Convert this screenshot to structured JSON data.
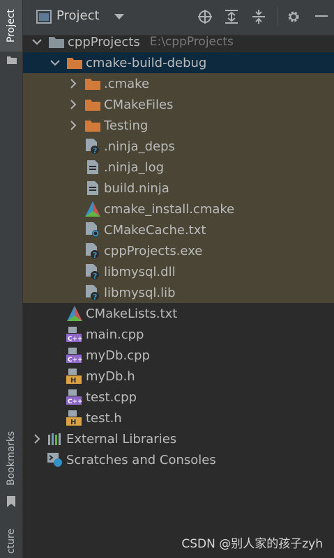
{
  "side_tabs": {
    "project": "Project",
    "bookmarks": "Bookmarks",
    "structure": "cture"
  },
  "header": {
    "title": "Project"
  },
  "tree": {
    "root": {
      "name": "cppProjects",
      "path": "E:\\cppProjects"
    },
    "build_dir": "cmake-build-debug",
    "build_items": [
      {
        "name": ".cmake",
        "kind": "folder"
      },
      {
        "name": "CMakeFiles",
        "kind": "folder"
      },
      {
        "name": "Testing",
        "kind": "folder"
      },
      {
        "name": ".ninja_deps",
        "kind": "unknown"
      },
      {
        "name": ".ninja_log",
        "kind": "text"
      },
      {
        "name": "build.ninja",
        "kind": "text"
      },
      {
        "name": "cmake_install.cmake",
        "kind": "cmake"
      },
      {
        "name": "CMakeCache.txt",
        "kind": "settings"
      },
      {
        "name": "cppProjects.exe",
        "kind": "unknown"
      },
      {
        "name": "libmysql.dll",
        "kind": "unknown"
      },
      {
        "name": "libmysql.lib",
        "kind": "unknown"
      }
    ],
    "files": [
      {
        "name": "CMakeLists.txt",
        "kind": "cmake"
      },
      {
        "name": "main.cpp",
        "kind": "cpp"
      },
      {
        "name": "myDb.cpp",
        "kind": "cpp"
      },
      {
        "name": "myDb.h",
        "kind": "header"
      },
      {
        "name": "test.cpp",
        "kind": "cpp"
      },
      {
        "name": "test.h",
        "kind": "header"
      }
    ],
    "external_libraries": "External Libraries",
    "scratches": "Scratches and Consoles"
  },
  "watermark": "CSDN @别人家的孩子zyh",
  "colors": {
    "selection": "#0d293e",
    "excluded": "#4b4535",
    "folder": "#d27a3a",
    "text": "#bbbbbb"
  }
}
